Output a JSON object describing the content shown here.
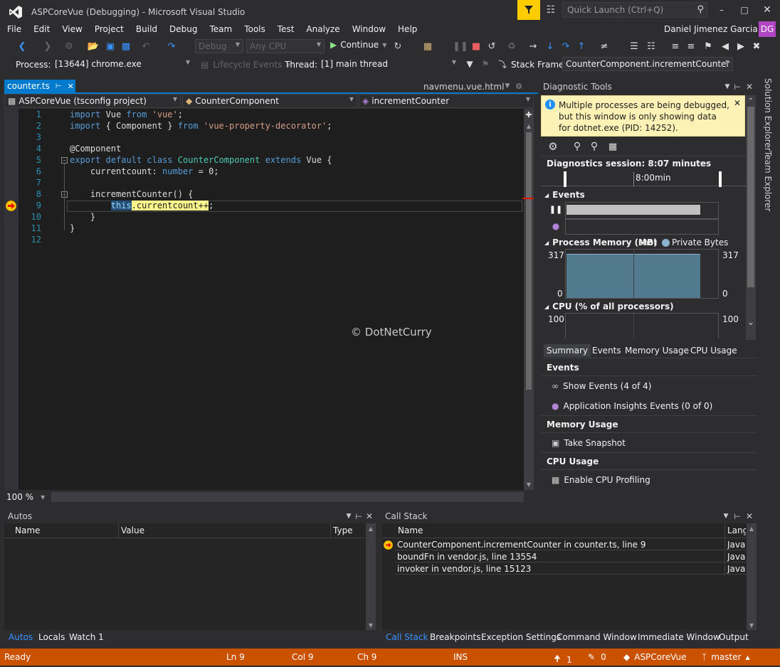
{
  "window": {
    "title": "ASPCoreVue (Debugging) - Microsoft Visual Studio",
    "quick_launch_placeholder": "Quick Launch (Ctrl+Q)",
    "user": "Daniel Jimenez Garcia",
    "user_initials": "DG"
  },
  "menu": [
    "File",
    "Edit",
    "View",
    "Project",
    "Build",
    "Debug",
    "Team",
    "Tools",
    "Test",
    "Analyze",
    "Window",
    "Help"
  ],
  "toolbar": {
    "config": "Debug",
    "platform": "Any CPU",
    "continue_label": "Continue"
  },
  "debug_bar": {
    "process_label": "Process:",
    "process_value": "[13644] chrome.exe",
    "lifecycle_label": "Lifecycle Events",
    "thread_label": "Thread:",
    "thread_value": "[1] main thread",
    "stack_frame_label": "Stack Frame:",
    "stack_frame_value": "CounterComponent.incrementCounter in"
  },
  "editor": {
    "active_tab": "counter.ts",
    "other_tab": "navmenu.vue.html",
    "project_dd": "ASPCoreVue (tsconfig project)",
    "class_dd": "CounterComponent",
    "member_dd": "incrementCounter",
    "zoom": "100 %",
    "line_numbers": [
      "1",
      "2",
      "3",
      "4",
      "5",
      "6",
      "7",
      "8",
      "9",
      "10",
      "11",
      "12"
    ],
    "watermark": "© DotNetCurry"
  },
  "diagnostics": {
    "title": "Diagnostic Tools",
    "info": "Multiple processes are being debugged, but this window is only showing data for dotnet.exe (PID: 14252).",
    "session": "Diagnostics session: 8:07 minutes",
    "timeline_label": "8:00min",
    "events_header": "Events",
    "memory_header": "Process Memory (MB)",
    "memory_legend_a": "shot",
    "memory_legend_b": "Private Bytes",
    "mem_max": "317",
    "mem_min": "0",
    "cpu_header": "CPU (% of all processors)",
    "cpu_max": "100",
    "tabs": [
      "Summary",
      "Events",
      "Memory Usage",
      "CPU Usage"
    ],
    "summary": {
      "events_h": "Events",
      "show_events": "Show Events (4 of 4)",
      "app_insights": "Application Insights Events (0 of 0)",
      "memory_h": "Memory Usage",
      "take_snapshot": "Take Snapshot",
      "cpu_h": "CPU Usage",
      "enable_cpu": "Enable CPU Profiling"
    }
  },
  "autos": {
    "title": "Autos",
    "columns": [
      "Name",
      "Value",
      "Type"
    ],
    "tabs": [
      "Autos",
      "Locals",
      "Watch 1"
    ]
  },
  "callstack": {
    "title": "Call Stack",
    "columns": [
      "Name",
      "Lang"
    ],
    "rows": [
      {
        "name": "CounterComponent.incrementCounter in counter.ts, line 9",
        "lang": "JavaS"
      },
      {
        "name": "boundFn in vendor.js, line 13554",
        "lang": "JavaS"
      },
      {
        "name": "invoker in vendor.js, line 15123",
        "lang": "JavaS"
      }
    ],
    "tabs": [
      "Call Stack",
      "Breakpoints",
      "Exception Settings",
      "Command Window",
      "Immediate Window",
      "Output"
    ]
  },
  "side_tabs": [
    "Solution Explorer",
    "Team Explorer"
  ],
  "status": {
    "ready": "Ready",
    "ln": "Ln 9",
    "col": "Col 9",
    "ch": "Ch 9",
    "ins": "INS",
    "up": "1",
    "pencil": "0",
    "repo": "ASPCoreVue",
    "branch": "master"
  },
  "colors": {
    "accent": "#007acc",
    "statusbar": "#ca5100",
    "yellow": "#ffcc00"
  }
}
